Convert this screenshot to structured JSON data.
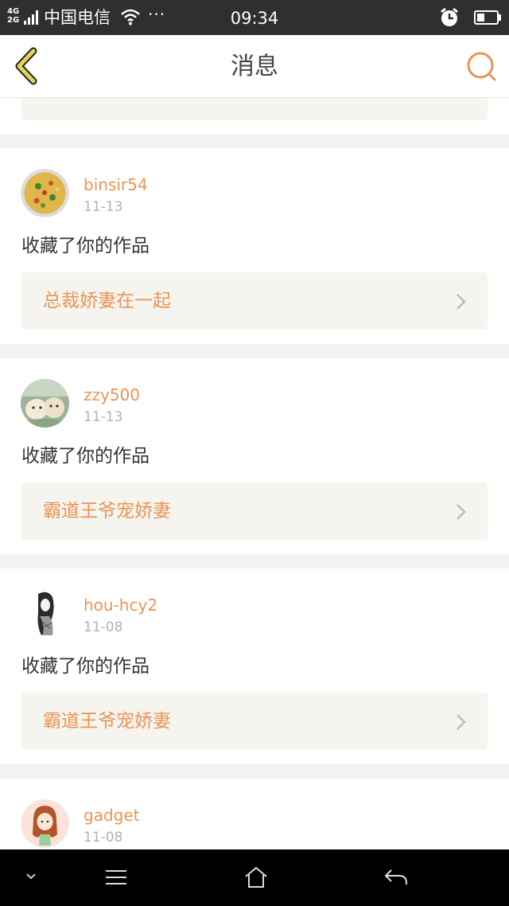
{
  "status_bar": {
    "network": "4G\n2G",
    "carrier": "中国电信",
    "dots": "···",
    "time": "09:34",
    "icons": [
      "signal-icon",
      "wifi-icon",
      "alarm-icon",
      "battery-icon"
    ]
  },
  "header": {
    "title": "消息",
    "back_icon": "back-chevron-icon",
    "search_icon": "search-icon",
    "colors": {
      "back": "#d4c24a",
      "search": "#eb9456"
    }
  },
  "colors": {
    "accent": "#eb9456",
    "link_bg": "#f5f4ef",
    "date": "#b3b3b3",
    "text": "#333333"
  },
  "messages": [
    {
      "username": "binsir54",
      "date": "11-13",
      "action": "收藏了你的作品",
      "work": "总裁娇妻在一起",
      "avatar": "food-avatar"
    },
    {
      "username": "zzy500",
      "date": "11-13",
      "action": "收藏了你的作品",
      "work": "霸道王爷宠娇妻",
      "avatar": "puppies-avatar"
    },
    {
      "username": "hou-hcy2",
      "date": "11-08",
      "action": "收藏了你的作品",
      "work": "霸道王爷宠娇妻",
      "avatar": "sketch-girl-avatar"
    },
    {
      "username": "gadget",
      "date": "11-08",
      "avatar": "cartoon-girl-avatar"
    }
  ],
  "nav_bar": {
    "icons": [
      "nav-down-icon",
      "nav-menu-icon",
      "nav-home-icon",
      "nav-back-icon"
    ]
  }
}
